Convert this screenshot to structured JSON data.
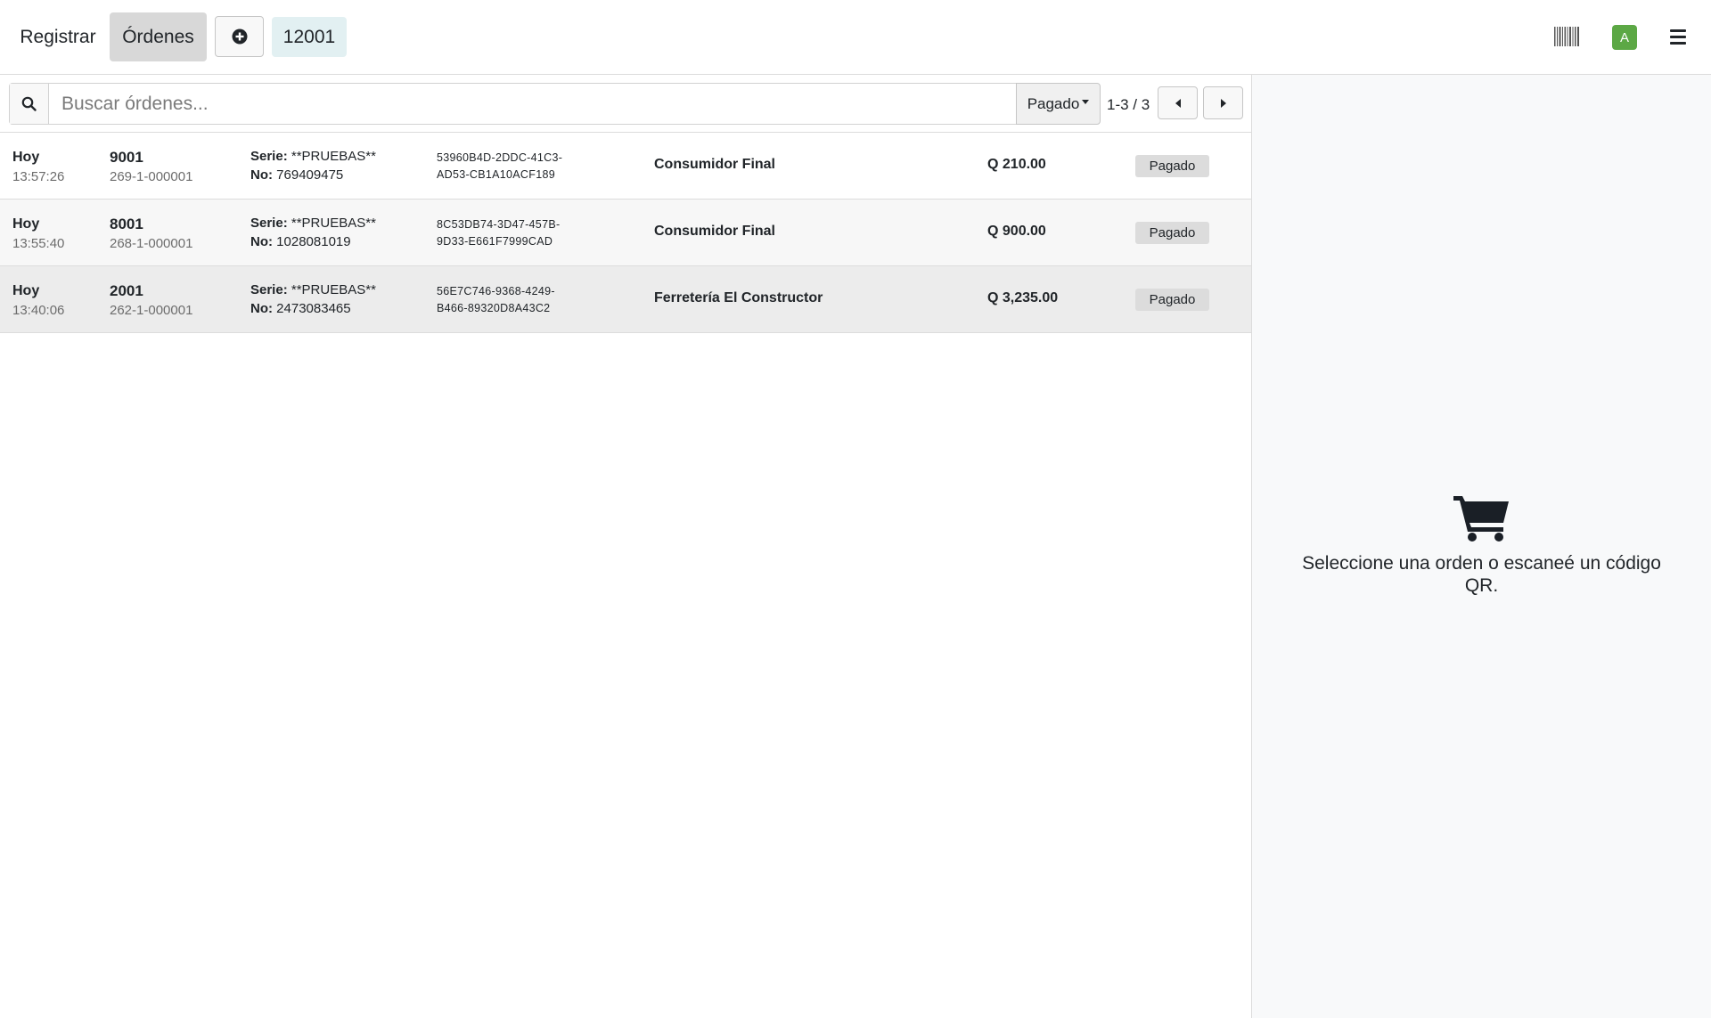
{
  "navbar": {
    "register_label": "Registrar",
    "orders_label": "Órdenes",
    "new_order_icon": "plus-circle-icon",
    "current_order": "12001",
    "barcode_icon": "barcode-icon",
    "avatar_initial": "A",
    "menu_icon": "hamburger-icon",
    "accent_color": "#5ca845"
  },
  "search": {
    "placeholder": "Buscar órdenes...",
    "value": "",
    "filter_label": "Pagado",
    "pager_text": "1-3 / 3"
  },
  "orders": [
    {
      "day": "Hoy",
      "time": "13:57:26",
      "number": "9001",
      "reference": "269-1-000001",
      "serie_label": "Serie:",
      "serie_value": "**PRUEBAS**",
      "no_label": "No:",
      "no_value": "769409475",
      "uuid_line1": "53960B4D-2DDC-41C3-",
      "uuid_line2": "AD53-CB1A10ACF189",
      "customer": "Consumidor Final",
      "total": "Q 210.00",
      "status": "Pagado"
    },
    {
      "day": "Hoy",
      "time": "13:55:40",
      "number": "8001",
      "reference": "268-1-000001",
      "serie_label": "Serie:",
      "serie_value": "**PRUEBAS**",
      "no_label": "No:",
      "no_value": "1028081019",
      "uuid_line1": "8C53DB74-3D47-457B-",
      "uuid_line2": "9D33-E661F7999CAD",
      "customer": "Consumidor Final",
      "total": "Q 900.00",
      "status": "Pagado"
    },
    {
      "day": "Hoy",
      "time": "13:40:06",
      "number": "2001",
      "reference": "262-1-000001",
      "serie_label": "Serie:",
      "serie_value": "**PRUEBAS**",
      "no_label": "No:",
      "no_value": "2473083465",
      "uuid_line1": "56E7C746-9368-4249-",
      "uuid_line2": "B466-89320D8A43C2",
      "customer": "Ferretería El Constructor",
      "total": "Q 3,235.00",
      "status": "Pagado"
    }
  ],
  "empty_state": {
    "icon": "shopping-cart-icon",
    "message": "Seleccione una orden o escaneé un código QR."
  }
}
